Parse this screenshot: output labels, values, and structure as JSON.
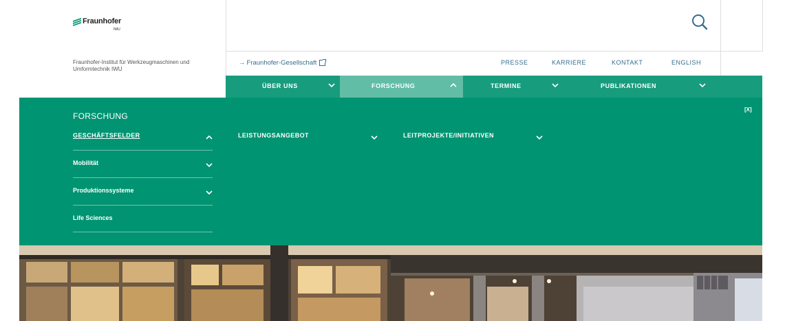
{
  "logo": {
    "name": "Fraunhofer",
    "sub": "IWU"
  },
  "institute": "Fraunhofer-Institut für Werkzeugmaschinen und Umformtechnik IWU",
  "search": {
    "icon": "search-icon"
  },
  "meta_nav": {
    "external_link": "Fraunhofer-Gesellschaft",
    "presse": "PRESSE",
    "karriere": "KARRIERE",
    "kontakt": "KONTAKT",
    "english": "ENGLISH"
  },
  "main_nav": [
    {
      "label": "ÜBER UNS",
      "expanded": false
    },
    {
      "label": "FORSCHUNG",
      "expanded": true
    },
    {
      "label": "TERMINE",
      "expanded": false
    },
    {
      "label": "PUBLIKATIONEN",
      "expanded": false
    }
  ],
  "dropdown": {
    "title": "FORSCHUNG",
    "close": "[X]",
    "columns": [
      {
        "label": "GESCHÄFTSFELDER",
        "expanded": true
      },
      {
        "label": "LEISTUNGSANGEBOT",
        "expanded": false
      },
      {
        "label": "LEITPROJEKTE/INITIATIVEN",
        "expanded": false
      }
    ],
    "sub_items": [
      {
        "label": "Mobilität",
        "has_children": true
      },
      {
        "label": "Produktionssysteme",
        "has_children": true
      },
      {
        "label": "Life Sciences",
        "has_children": false
      }
    ]
  },
  "colors": {
    "brand_green": "#179c7d",
    "dropdown_green": "#009472",
    "active_tab": "#62bda6",
    "link_blue": "#336e8c"
  }
}
